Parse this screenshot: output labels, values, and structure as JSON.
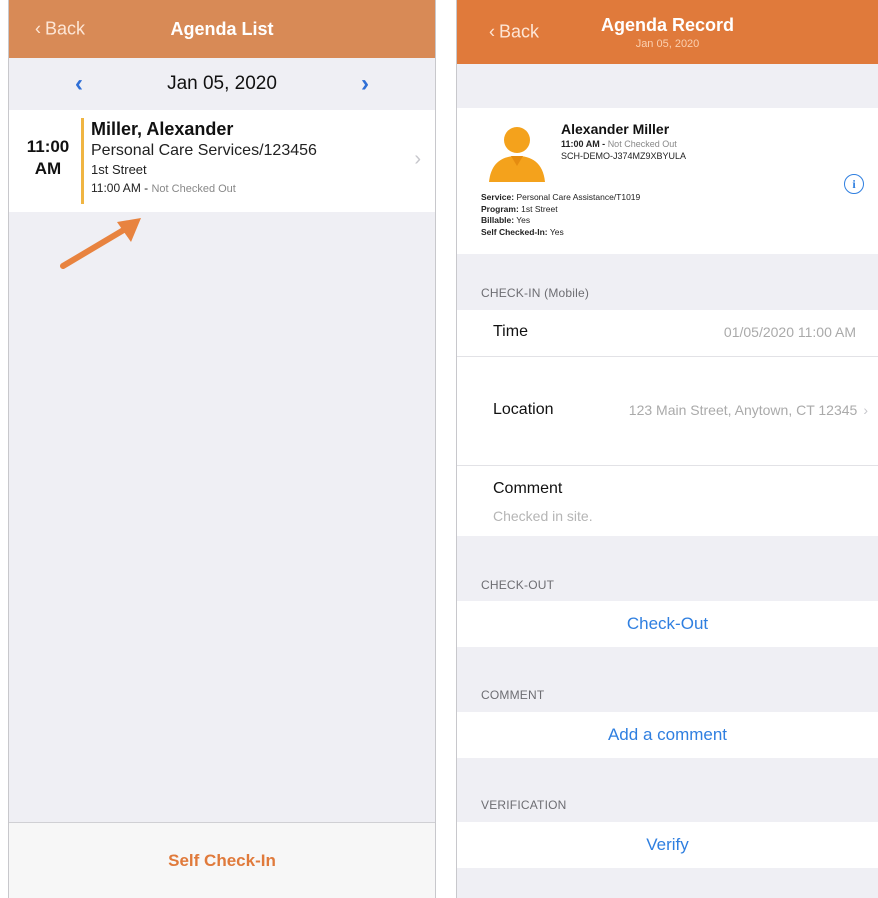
{
  "left": {
    "nav": {
      "back_label": "Back",
      "title": "Agenda List"
    },
    "date": {
      "label": "Jan 05, 2020"
    },
    "agenda_item": {
      "time_line1": "11:00",
      "time_line2": "AM",
      "name": "Miller, Alexander",
      "service": "Personal Care Services/123456",
      "program": "1st Street",
      "status_time": "11:00 AM - ",
      "status_text": "Not Checked Out"
    },
    "tabbar": {
      "action_label": "Self Check-In"
    }
  },
  "right": {
    "nav": {
      "back_label": "Back",
      "title": "Agenda Record",
      "subtitle": "Jan 05, 2020"
    },
    "client": {
      "name": "Alexander Miller",
      "time": "11:00 AM - ",
      "time_status": "Not Checked Out",
      "id": "SCH-DEMO-J374MZ9XBYULA",
      "service_label": "Service:",
      "service_value": "Personal Care Assistance/T1019",
      "program_label": "Program:",
      "program_value": "1st Street",
      "billable_label": "Billable:",
      "billable_value": "Yes",
      "self_checked_in_label": "Self Checked-In:",
      "self_checked_in_value": "Yes"
    },
    "checkin": {
      "header": "CHECK-IN (Mobile)",
      "time_label": "Time",
      "time_value": "01/05/2020 11:00 AM",
      "location_label": "Location",
      "location_value": "123 Main Street, Anytown, CT 12345",
      "comment_label": "Comment",
      "comment_value": "Checked in site."
    },
    "checkout": {
      "header": "CHECK-OUT",
      "action": "Check-Out"
    },
    "comment": {
      "header": "COMMENT",
      "action": "Add a comment"
    },
    "verification": {
      "header": "VERIFICATION",
      "action": "Verify"
    }
  },
  "colors": {
    "nav_left": "#d88a56",
    "nav_right": "#e07a3b",
    "accent_blue": "#2f7fe0",
    "agenda_bar": "#f0b542",
    "arrow": "#e8833f"
  },
  "icons": {
    "back": "chevron-left-icon",
    "prev_date": "chevron-left-icon",
    "next_date": "chevron-right-icon",
    "row_disclosure": "chevron-right-icon",
    "avatar": "person-avatar-icon",
    "info": "info-circle-icon",
    "pointer": "arrow-pointer-icon"
  }
}
